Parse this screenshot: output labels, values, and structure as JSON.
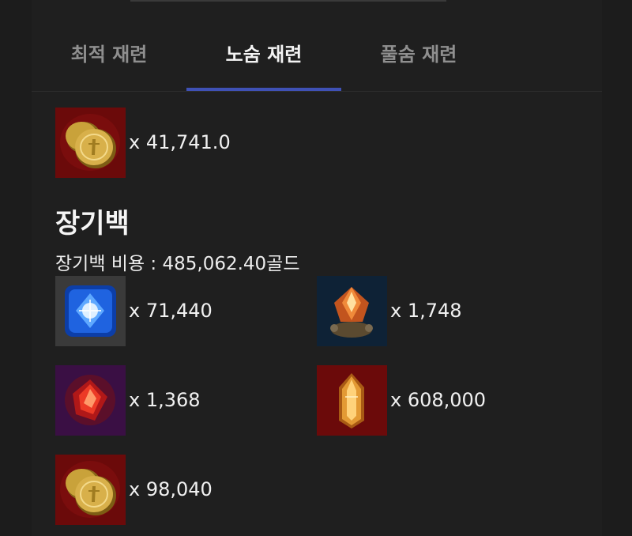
{
  "tabs": [
    {
      "label": "최적 재련",
      "active": false
    },
    {
      "label": "노숨 재련",
      "active": true
    },
    {
      "label": "풀숨 재련",
      "active": false
    }
  ],
  "colors": {
    "accent": "#3f51b5",
    "background": "#1c1c1c",
    "gold_tile": "#6b0a0a",
    "blue_tile": "#3a3a3a",
    "orange_tile": "#0e2236",
    "red_tile": "#3a0f44"
  },
  "top_item": {
    "icon": "gold-coins-icon",
    "qty": "x 41,741.0"
  },
  "section": {
    "title": "장기백",
    "cost_label": "장기백 비용 : 485,062.40골드"
  },
  "items": [
    {
      "icon": "blue-gem-icon",
      "qty": "x 71,440"
    },
    {
      "icon": "orange-crystal-icon",
      "qty": "x 1,748"
    },
    {
      "icon": "red-gem-icon",
      "qty": "x 1,368"
    },
    {
      "icon": "amber-crystal-icon",
      "qty": "x 608,000"
    },
    {
      "icon": "gold-coins-icon",
      "qty": "x 98,040"
    }
  ]
}
